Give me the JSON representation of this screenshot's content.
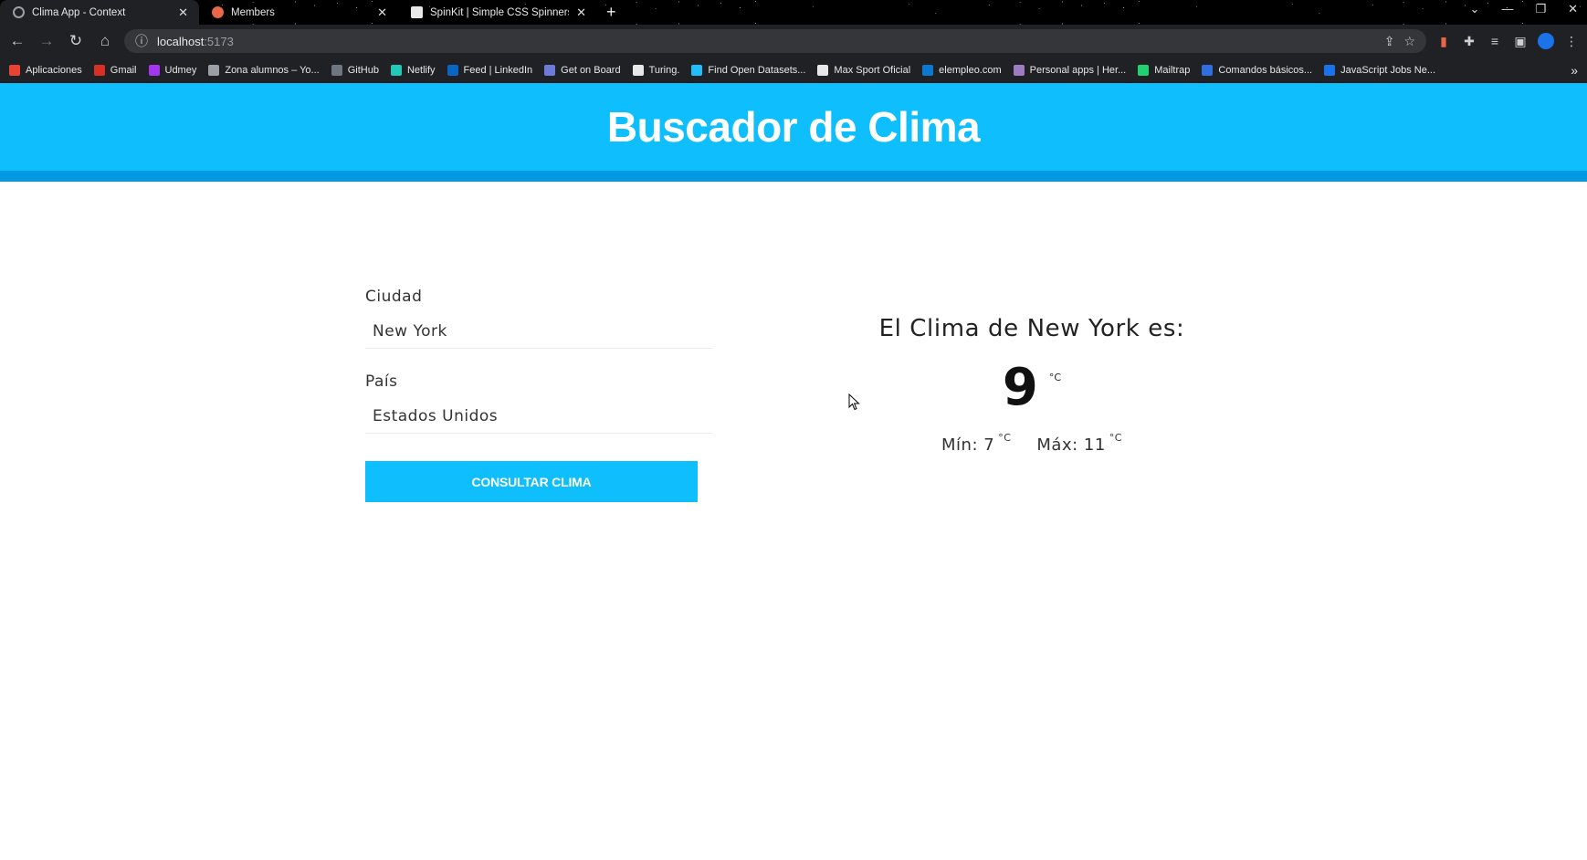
{
  "browser": {
    "tabs": [
      {
        "title": "Clima App - Context",
        "active": true,
        "favicon_color": "#9aa0a6"
      },
      {
        "title": "Members",
        "active": false,
        "favicon_color": "#e8674a"
      },
      {
        "title": "SpinKit | Simple CSS Spinners",
        "active": false,
        "favicon_color": "#e8e8e8"
      }
    ],
    "new_tab_glyph": "+",
    "address": {
      "host": "localhost",
      "port": ":5173"
    },
    "bookmarks": [
      {
        "label": "Aplicaciones",
        "color": "#ea4335"
      },
      {
        "label": "Gmail",
        "color": "#d93025"
      },
      {
        "label": "Udmey",
        "color": "#a435f0"
      },
      {
        "label": "Zona alumnos – Yo...",
        "color": "#9aa0a6"
      },
      {
        "label": "GitHub",
        "color": "#6e7681"
      },
      {
        "label": "Netlify",
        "color": "#25c7b7"
      },
      {
        "label": "Feed | LinkedIn",
        "color": "#0a66c2"
      },
      {
        "label": "Get on Board",
        "color": "#6c7bd8"
      },
      {
        "label": "Turing.",
        "color": "#e8e8e8"
      },
      {
        "label": "Find Open Datasets...",
        "color": "#20beff"
      },
      {
        "label": "Max Sport Oficial",
        "color": "#e8e8e8"
      },
      {
        "label": "elempleo.com",
        "color": "#0b79d0"
      },
      {
        "label": "Personal apps | Her...",
        "color": "#9e7cc1"
      },
      {
        "label": "Mailtrap",
        "color": "#22d172"
      },
      {
        "label": "Comandos básicos...",
        "color": "#2f6fde"
      },
      {
        "label": "JavaScript Jobs Ne...",
        "color": "#1a73e8"
      }
    ],
    "bookmarks_overflow": "»"
  },
  "app": {
    "title": "Buscador de Clima",
    "form": {
      "city_label": "Ciudad",
      "city_value": "New York",
      "country_label": "País",
      "country_value": "Estados Unidos",
      "submit_label": "Consultar clima"
    },
    "result": {
      "heading": "El Clima de New York es:",
      "temp": "9",
      "unit": "°C",
      "min_label": "Mín: 7",
      "max_label": "Máx: 11"
    }
  },
  "colors": {
    "header_bg": "#0fbefc",
    "header_strip": "#0399e3",
    "button_bg": "#0fbefc"
  }
}
